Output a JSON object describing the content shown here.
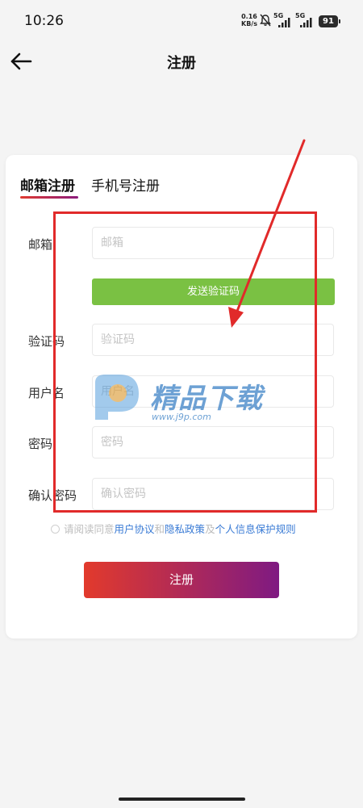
{
  "status_bar": {
    "time": "10:26",
    "net_speed_value": "0.16",
    "net_speed_unit": "KB/s",
    "sim1_label": "5G",
    "sim2_label": "5G",
    "battery": "91",
    "icons": [
      "mute-bell-icon",
      "signal-icon",
      "signal-icon",
      "battery-icon"
    ]
  },
  "header": {
    "back_icon": "back-arrow-icon",
    "title": "注册"
  },
  "tabs": [
    {
      "label": "邮箱注册",
      "active": true
    },
    {
      "label": "手机号注册",
      "active": false
    }
  ],
  "form": {
    "email": {
      "label": "邮箱",
      "placeholder": "邮箱"
    },
    "send_code_label": "发送验证码",
    "code": {
      "label": "验证码",
      "placeholder": "验证码"
    },
    "username": {
      "label": "用户名",
      "placeholder": "用户名"
    },
    "password": {
      "label": "密码",
      "placeholder": "密码"
    },
    "confirm_password": {
      "label": "确认密码",
      "placeholder": "确认密码"
    }
  },
  "agreement": {
    "prefix": "请阅读同意",
    "link1": "用户协议",
    "and": "和",
    "link2": "隐私政策",
    "conj": "及",
    "link3": "个人信息保护规则"
  },
  "register_button": "注册",
  "watermark": {
    "text": "精品下载",
    "url": "www.j9p.com"
  },
  "colors": {
    "send_button": "#7ac143",
    "register_gradient_start": "#e23a2c",
    "register_gradient_end": "#7f1a82",
    "link": "#3a7bd5",
    "annotation_red": "#e12a2a"
  }
}
